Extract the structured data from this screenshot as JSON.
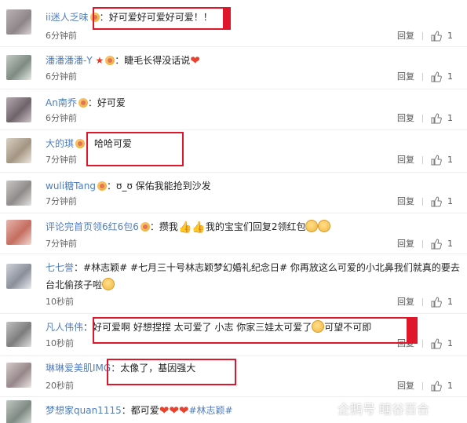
{
  "comments": [
    {
      "user": "ii迷人乏味",
      "text": "好可爱好可爱好可爱！！",
      "time": "6分钟前",
      "reply": "回复",
      "likes": "1"
    },
    {
      "user": "潘潘潘潘-Y",
      "text": "睫毛长得没话说",
      "time": "6分钟前",
      "reply": "回复",
      "likes": "1"
    },
    {
      "user": "An南乔",
      "text": "好可爱",
      "time": "6分钟前",
      "reply": "回复",
      "likes": "1"
    },
    {
      "user": "大的琪",
      "text": "哈哈可爱",
      "time": "7分钟前",
      "reply": "回复",
      "likes": "1"
    },
    {
      "user": "wuli糖Tang",
      "text": "ʊ_ʊ  保佑我能抢到沙发",
      "time": "7分钟前",
      "reply": "回复",
      "likes": "1"
    },
    {
      "user": "评论完首页领6红6包6",
      "text": "攒我",
      "text2": "我的宝宝们回复2领红包",
      "time": "7分钟前",
      "reply": "回复",
      "likes": "1"
    },
    {
      "user": "七七誉",
      "text": "#林志颖# #七月三十号林志颖梦幻婚礼纪念日# 你再放这么可爱的小北鼻我们就真的要去",
      "text_line2": "台北偷孩子啦",
      "time": "10秒前",
      "reply": "回复",
      "likes": "1"
    },
    {
      "user": "凡人伟伟",
      "text": "好可爱啊 好想捏捏 太可爱了 小志 你家三娃太可爱了",
      "text2": "可望不可即",
      "time": "10秒前",
      "reply": "回复",
      "likes": "1"
    },
    {
      "user": "琳琳爱美肌IMG",
      "text": "太像了，基因强大",
      "time": "20秒前",
      "reply": "回复",
      "likes": "1"
    },
    {
      "user": "梦想家quan1115",
      "text": "都可爱",
      "text2": "#林志颖#",
      "time": "",
      "reply": "",
      "likes": ""
    }
  ],
  "watermark": "企鹅号 瞎谷百合",
  "colors": {
    "username": "#4f7dbe",
    "highlight": "#e0162b"
  }
}
